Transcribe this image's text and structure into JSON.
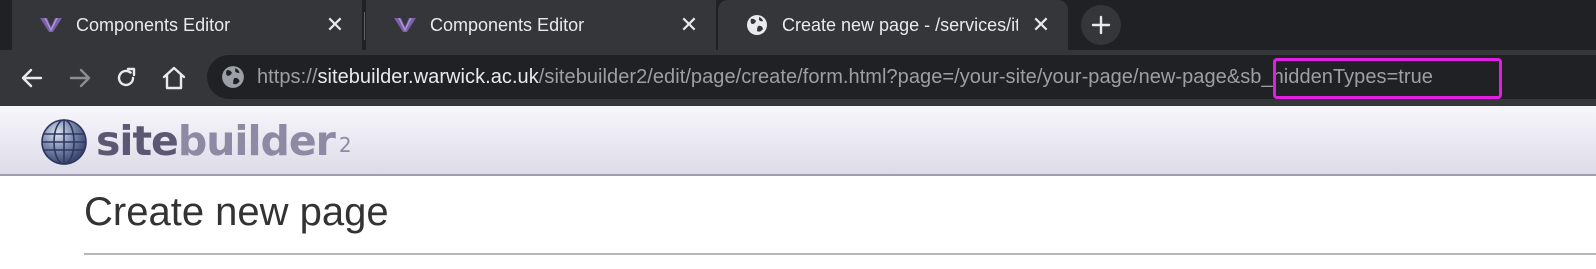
{
  "tabs": [
    {
      "title": "Components Editor",
      "favicon": "sitebuilder-tab-icon",
      "active": false
    },
    {
      "title": "Components Editor",
      "favicon": "sitebuilder-tab-icon",
      "active": false
    },
    {
      "title": "Create new page - /services/its/i",
      "favicon": "globe-icon",
      "active": true
    }
  ],
  "toolbar": {
    "url_scheme": "https://",
    "url_host": "sitebuilder.warwick.ac.uk",
    "url_path": "/sitebuilder2/edit/page/create/form.html?page=/your-site/your-page/new-page",
    "url_param": "&sb_hiddenTypes=true"
  },
  "header": {
    "logo_part1": "site",
    "logo_part2": "builder",
    "logo_sup": "2"
  },
  "page": {
    "title": "Create new page"
  },
  "colors": {
    "highlight": "#e11ee1",
    "tab_bg": "#35363a",
    "strip_bg": "#202124"
  }
}
